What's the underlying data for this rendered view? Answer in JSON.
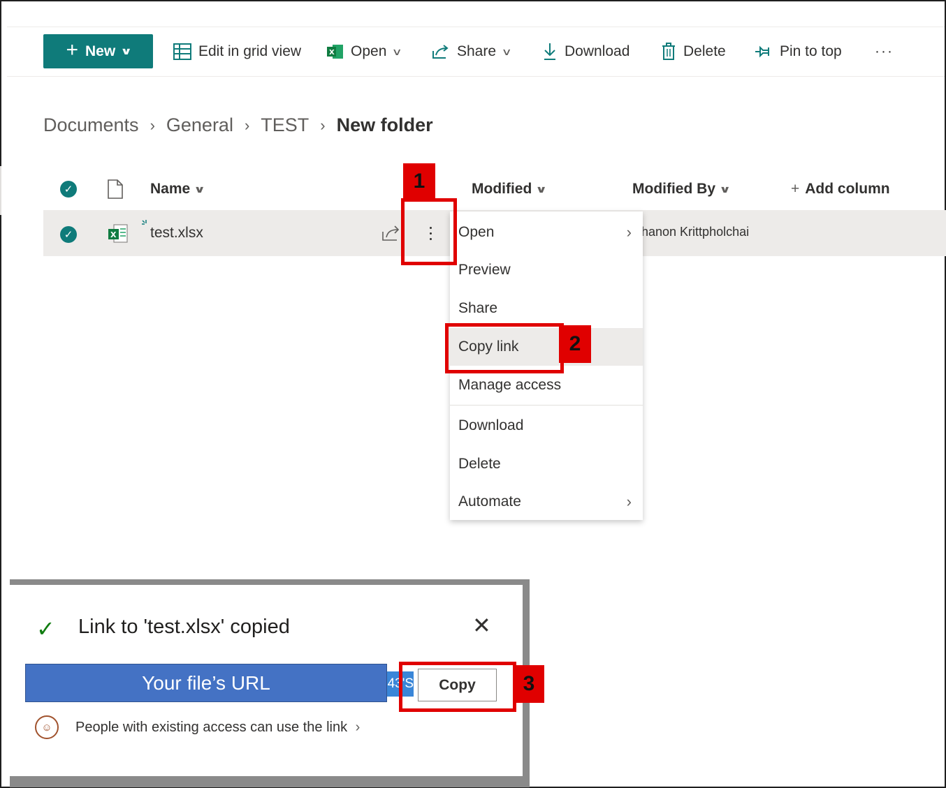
{
  "toolbar": {
    "new_label": "New",
    "edit_grid_label": "Edit in grid view",
    "open_label": "Open",
    "share_label": "Share",
    "download_label": "Download",
    "delete_label": "Delete",
    "pin_label": "Pin to top",
    "more_label": "···"
  },
  "breadcrumb": [
    "Documents",
    "General",
    "TEST",
    "New folder"
  ],
  "columns": {
    "name": "Name",
    "modified": "Modified",
    "modified_by": "Modified By",
    "add_column": "Add column"
  },
  "file_row": {
    "name": "test.xlsx",
    "modified_by": "hanon Krittpholchai"
  },
  "context_menu": [
    {
      "label": "Open",
      "submenu": true
    },
    {
      "label": "Preview",
      "submenu": false
    },
    {
      "label": "Share",
      "submenu": false
    },
    {
      "label": "Copy link",
      "submenu": false
    },
    {
      "label": "Manage access",
      "submenu": false
    },
    {
      "label": "Download",
      "submenu": false
    },
    {
      "label": "Delete",
      "submenu": false
    },
    {
      "label": "Automate",
      "submenu": true
    }
  ],
  "annotations": [
    "1",
    "2",
    "3"
  ],
  "dialog": {
    "title": "Link to 'test.xlsx' copied",
    "url_label": "Your file’s URL",
    "url_tail": "43'S",
    "copy_label": "Copy",
    "access_text": "People with existing access can use the link",
    "access_chevron": "›"
  },
  "colors": {
    "brand": "#0f7b7a",
    "annotation": "#e00000",
    "url_highlight": "#4472c4",
    "success": "#107c10"
  }
}
